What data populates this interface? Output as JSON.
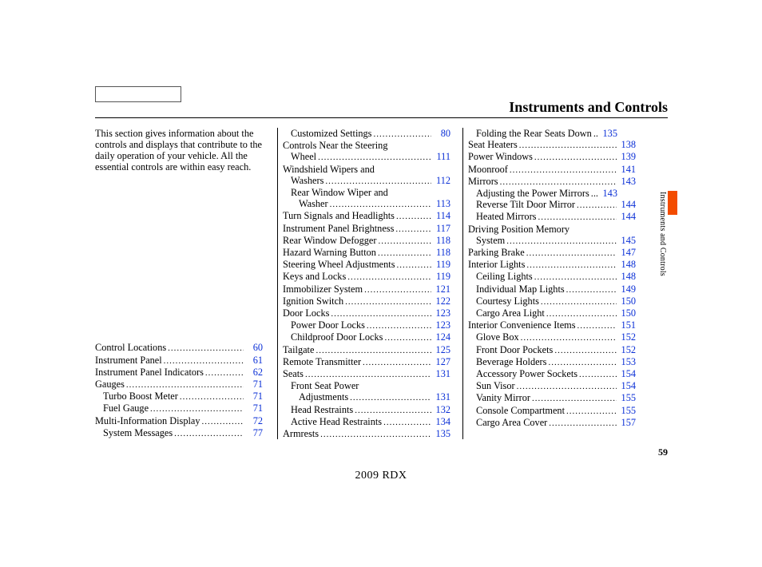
{
  "header": {
    "main_menu_label": "",
    "section_title": "Instruments and Controls"
  },
  "footer": {
    "model_year": "2009  RDX",
    "page_number": "59",
    "side_tab_text": "Instruments and Controls"
  },
  "intro_text": "This section gives information about the controls and displays that contribute to the daily operation of your vehicle. All the essential controls are within easy reach.",
  "col1": [
    {
      "label": "Control Locations",
      "page": "60",
      "indent": 0
    },
    {
      "label": "Instrument Panel",
      "page": "61",
      "indent": 0
    },
    {
      "label": "Instrument Panel Indicators",
      "page": "62",
      "indent": 0
    },
    {
      "label": "Gauges",
      "page": "71",
      "indent": 0
    },
    {
      "label": "Turbo Boost Meter",
      "page": "71",
      "indent": 1
    },
    {
      "label": "Fuel Gauge",
      "page": "71",
      "indent": 1
    },
    {
      "label": "Multi-Information Display",
      "page": "72",
      "indent": 0
    },
    {
      "label": "System Messages",
      "page": "77",
      "indent": 1
    }
  ],
  "col2": [
    {
      "label": "Customized Settings",
      "page": "80",
      "indent": 1
    },
    {
      "label": "Controls Near the Steering",
      "page": "",
      "indent": 0,
      "nodots": true
    },
    {
      "label": "Wheel",
      "page": "111",
      "indent": 1
    },
    {
      "label": "Windshield Wipers and",
      "page": "",
      "indent": 0,
      "nodots": true
    },
    {
      "label": "Washers",
      "page": "112",
      "indent": 1
    },
    {
      "label": "Rear Window Wiper and",
      "page": "",
      "indent": 1,
      "nodots": true
    },
    {
      "label": "Washer",
      "page": "113",
      "indent": 2
    },
    {
      "label": "Turn Signals and Headlights",
      "page": "114",
      "indent": 0
    },
    {
      "label": "Instrument Panel Brightness",
      "page": "117",
      "indent": 0
    },
    {
      "label": "Rear Window Defogger",
      "page": "118",
      "indent": 0
    },
    {
      "label": "Hazard Warning Button",
      "page": "118",
      "indent": 0
    },
    {
      "label": "Steering Wheel Adjustments",
      "page": "119",
      "indent": 0
    },
    {
      "label": "Keys and Locks",
      "page": "119",
      "indent": 0
    },
    {
      "label": "Immobilizer System",
      "page": "121",
      "indent": 0
    },
    {
      "label": "Ignition Switch",
      "page": "122",
      "indent": 0
    },
    {
      "label": "Door Locks",
      "page": "123",
      "indent": 0
    },
    {
      "label": "Power Door Locks",
      "page": "123",
      "indent": 1
    },
    {
      "label": "Childproof Door Locks",
      "page": "124",
      "indent": 1
    },
    {
      "label": "Tailgate",
      "page": "125",
      "indent": 0
    },
    {
      "label": "Remote Transmitter",
      "page": "127",
      "indent": 0
    },
    {
      "label": "Seats",
      "page": "131",
      "indent": 0
    },
    {
      "label": "Front Seat Power",
      "page": "",
      "indent": 1,
      "nodots": true
    },
    {
      "label": "Adjustments",
      "page": "131",
      "indent": 2
    },
    {
      "label": "Head Restraints",
      "page": "132",
      "indent": 1
    },
    {
      "label": "Active Head Restraints",
      "page": "134",
      "indent": 1
    },
    {
      "label": "Armrests",
      "page": "135",
      "indent": 0
    }
  ],
  "col3": [
    {
      "label": "Folding the Rear Seats Down",
      "page": "135",
      "indent": 1,
      "leader_override": " .. "
    },
    {
      "label": "Seat Heaters",
      "page": "138",
      "indent": 0
    },
    {
      "label": "Power Windows",
      "page": "139",
      "indent": 0
    },
    {
      "label": "Moonroof",
      "page": "141",
      "indent": 0
    },
    {
      "label": "Mirrors",
      "page": "143",
      "indent": 0
    },
    {
      "label": "Adjusting the Power Mirrors",
      "page": "143",
      "indent": 1,
      "leader_override": " ... "
    },
    {
      "label": "Reverse Tilt Door Mirror",
      "page": "144",
      "indent": 1
    },
    {
      "label": "Heated Mirrors",
      "page": "144",
      "indent": 1
    },
    {
      "label": "Driving Position Memory",
      "page": "",
      "indent": 0,
      "nodots": true
    },
    {
      "label": "System",
      "page": "145",
      "indent": 1
    },
    {
      "label": "Parking Brake",
      "page": "147",
      "indent": 0
    },
    {
      "label": "Interior Lights",
      "page": "148",
      "indent": 0
    },
    {
      "label": "Ceiling Lights",
      "page": "148",
      "indent": 1
    },
    {
      "label": "Individual Map Lights",
      "page": "149",
      "indent": 1
    },
    {
      "label": "Courtesy Lights",
      "page": "150",
      "indent": 1
    },
    {
      "label": "Cargo Area Light",
      "page": "150",
      "indent": 1
    },
    {
      "label": "Interior Convenience Items",
      "page": "151",
      "indent": 0
    },
    {
      "label": "Glove Box",
      "page": "152",
      "indent": 1
    },
    {
      "label": "Front Door Pockets",
      "page": "152",
      "indent": 1
    },
    {
      "label": "Beverage Holders",
      "page": "153",
      "indent": 1
    },
    {
      "label": "Accessory Power Sockets",
      "page": "154",
      "indent": 1
    },
    {
      "label": "Sun Visor",
      "page": "154",
      "indent": 1
    },
    {
      "label": "Vanity Mirror",
      "page": "155",
      "indent": 1
    },
    {
      "label": "Console Compartment",
      "page": "155",
      "indent": 1
    },
    {
      "label": "Cargo Area Cover",
      "page": "157",
      "indent": 1
    }
  ]
}
